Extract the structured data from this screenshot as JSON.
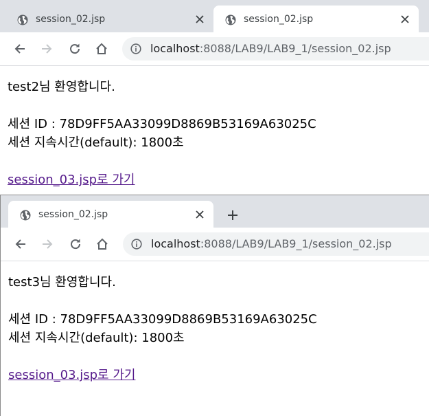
{
  "windows": [
    {
      "tabs": [
        {
          "title": "session_02.jsp",
          "active": false
        },
        {
          "title": "session_02.jsp",
          "active": true
        }
      ],
      "address": {
        "host": "localhost",
        "path": ":8088/LAB9/LAB9_1/session_02.jsp"
      },
      "page": {
        "welcome": "test2님 환영합니다.",
        "session_id_line": "세션 ID : 78D9FF5AA33099D8869B53169A63025C",
        "timeout_line": "세션 지속시간(default): 1800초",
        "link_text": "session_03.jsp로 가기"
      }
    },
    {
      "tabs": [
        {
          "title": "session_02.jsp",
          "active": true
        }
      ],
      "address": {
        "host": "localhost",
        "path": ":8088/LAB9/LAB9_1/session_02.jsp"
      },
      "page": {
        "welcome": "test3님 환영합니다.",
        "session_id_line": "세션 ID : 78D9FF5AA33099D8869B53169A63025C",
        "timeout_line": "세션 지속시간(default): 1800초",
        "link_text": "session_03.jsp로 가기"
      }
    }
  ],
  "colors": {
    "tabstrip": "#dee1e6",
    "link": "#551a8b",
    "omnibox": "#f1f3f4"
  },
  "icons": [
    "globe-icon",
    "close-icon",
    "new-tab-icon",
    "back-icon",
    "forward-icon",
    "reload-icon",
    "home-icon",
    "info-icon"
  ]
}
